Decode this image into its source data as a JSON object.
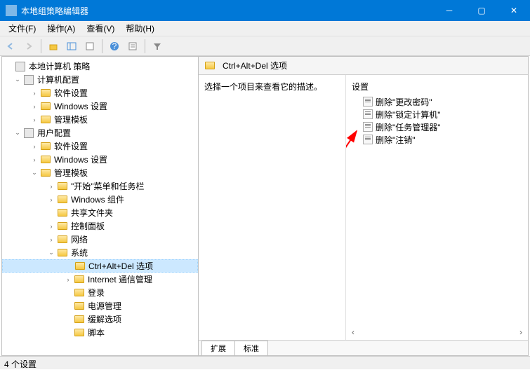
{
  "window": {
    "title": "本地组策略编辑器"
  },
  "menu": {
    "file": "文件(F)",
    "action": "操作(A)",
    "view": "查看(V)",
    "help": "帮助(H)"
  },
  "tree": {
    "root": "本地计算机 策略",
    "computer_config": "计算机配置",
    "cc_software": "软件设置",
    "cc_windows": "Windows 设置",
    "cc_admin": "管理模板",
    "user_config": "用户配置",
    "uc_software": "软件设置",
    "uc_windows": "Windows 设置",
    "uc_admin": "管理模板",
    "start_taskbar": "\"开始\"菜单和任务栏",
    "win_components": "Windows 组件",
    "shared_folders": "共享文件夹",
    "control_panel": "控制面板",
    "network": "网络",
    "system": "系统",
    "ctrl_alt_del": "Ctrl+Alt+Del 选项",
    "internet_comm": "Internet 通信管理",
    "logon": "登录",
    "power_mgmt": "电源管理",
    "mitigation": "缓解选项",
    "scripts": "脚本"
  },
  "right": {
    "header": "Ctrl+Alt+Del 选项",
    "desc": "选择一个项目来查看它的描述。",
    "settings_header": "设置",
    "items": {
      "change_pwd": "删除\"更改密码\"",
      "lock_computer": "删除\"锁定计算机\"",
      "task_manager": "删除\"任务管理器\"",
      "logoff": "删除\"注销\""
    }
  },
  "tabs": {
    "extended": "扩展",
    "standard": "标准"
  },
  "status": "4 个设置"
}
